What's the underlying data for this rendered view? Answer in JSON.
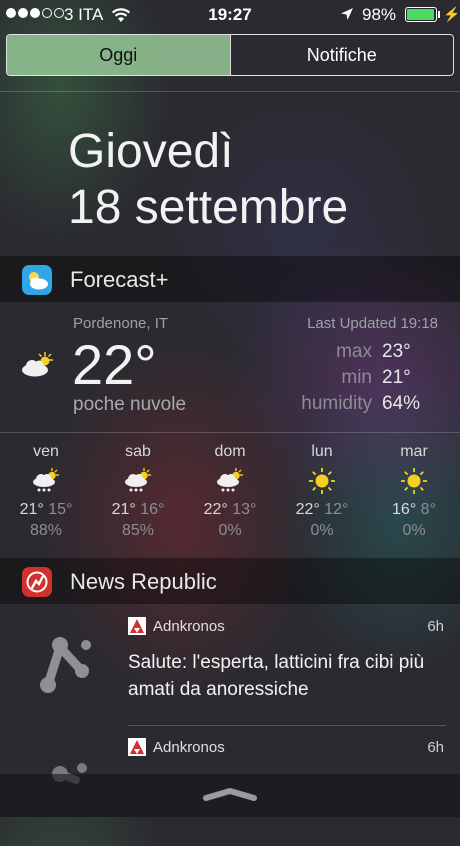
{
  "status_bar": {
    "carrier": "3 ITA",
    "time": "19:27",
    "battery": "98%",
    "battery_level": 0.98,
    "signal_bars_filled": 3,
    "signal_bars_total": 5
  },
  "tabs": [
    {
      "label": "Oggi",
      "active": true
    },
    {
      "label": "Notifiche",
      "active": false
    }
  ],
  "date": {
    "day": "Giovedì",
    "date": "18 settembre"
  },
  "forecast": {
    "app_name": "Forecast+",
    "location": "Pordenone, IT",
    "last_updated": "Last Updated 19:18",
    "temperature": "22°",
    "condition": "poche nuvole",
    "details": [
      {
        "label": "max",
        "value": "23°"
      },
      {
        "label": "min",
        "value": "21°"
      },
      {
        "label": "humidity",
        "value": "64%"
      }
    ],
    "days": [
      {
        "name": "ven",
        "icon": "rain-sun-icon",
        "high": "21°",
        "low": "15°",
        "precip": "88%"
      },
      {
        "name": "sab",
        "icon": "rain-sun-icon",
        "high": "21°",
        "low": "16°",
        "precip": "85%"
      },
      {
        "name": "dom",
        "icon": "rain-sun-icon",
        "high": "22°",
        "low": "13°",
        "precip": "0%"
      },
      {
        "name": "lun",
        "icon": "sun-icon",
        "high": "22°",
        "low": "12°",
        "precip": "0%"
      },
      {
        "name": "mar",
        "icon": "sun-icon",
        "high": "16°",
        "low": "8°",
        "precip": "0%"
      }
    ]
  },
  "news": {
    "app_name": "News Republic",
    "items": [
      {
        "source": "Adnkronos",
        "time": "6h",
        "title": "Salute: l'esperta, latticini fra cibi più amati da anoressiche"
      },
      {
        "source": "Adnkronos",
        "time": "6h",
        "title": ""
      }
    ]
  },
  "colors": {
    "accent_tab": "#96c896",
    "battery": "#4cd964",
    "sun": "#f5d020",
    "news_red": "#d32f2f",
    "forecast_blue": "#2fa6e8"
  }
}
